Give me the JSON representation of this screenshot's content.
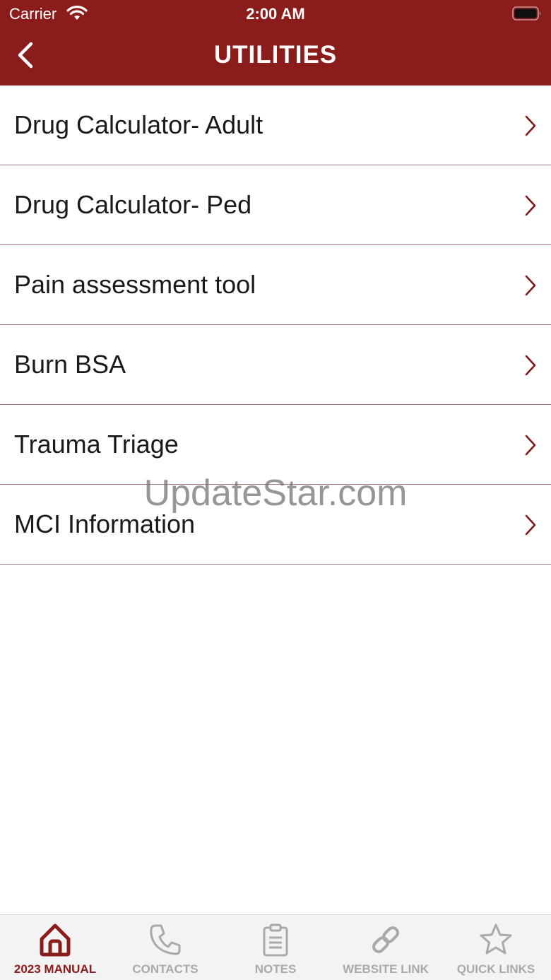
{
  "status_bar": {
    "carrier": "Carrier",
    "time": "2:00 AM",
    "icons": [
      "wifi-icon",
      "battery-icon"
    ]
  },
  "nav": {
    "title": "UTILITIES",
    "back_icon": "chevron-left-icon"
  },
  "list": {
    "items": [
      {
        "label": "Drug Calculator- Adult"
      },
      {
        "label": "Drug Calculator- Ped"
      },
      {
        "label": "Pain assessment tool"
      },
      {
        "label": "Burn BSA"
      },
      {
        "label": "Trauma Triage"
      },
      {
        "label": "MCI Information"
      }
    ],
    "chevron_icon": "chevron-right-icon"
  },
  "watermark": "UpdateStar.com",
  "tab_bar": {
    "tabs": [
      {
        "label": "2023 MANUAL",
        "icon": "home-icon",
        "active": true
      },
      {
        "label": "CONTACTS",
        "icon": "phone-icon",
        "active": false
      },
      {
        "label": "NOTES",
        "icon": "clipboard-icon",
        "active": false
      },
      {
        "label": "WEBSITE LINK",
        "icon": "link-icon",
        "active": false
      },
      {
        "label": "QUICK LINKS",
        "icon": "star-icon",
        "active": false
      }
    ]
  },
  "colors": {
    "brand": "#8a1c1b",
    "divider": "#a6797a",
    "tab_inactive": "#a9a9a9",
    "tab_bar_bg": "#f3f3f3"
  }
}
